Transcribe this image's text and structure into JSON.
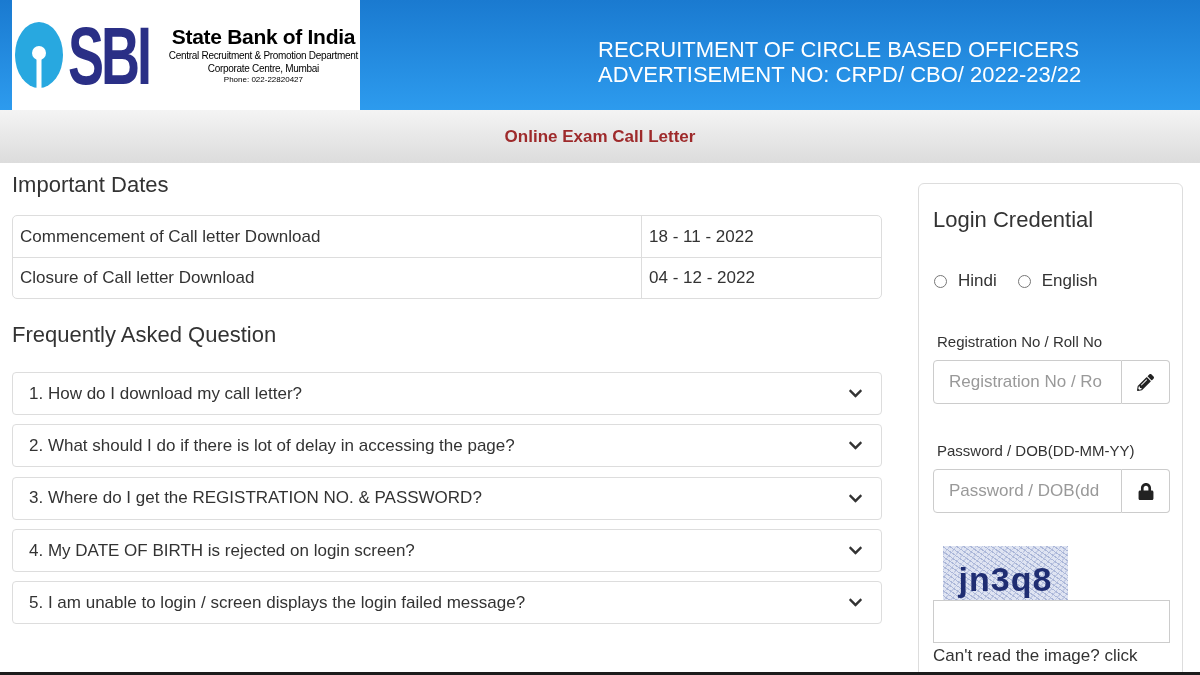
{
  "header": {
    "logo": {
      "mark": "SBI",
      "name": "State Bank of India",
      "department": "Central Recruitment & Promotion Department",
      "office": "Corporate Centre, Mumbai",
      "phone": "Phone: 022-22820427"
    },
    "title_lines": [
      "RECRUITMENT OF CIRCLE BASED OFFICERS",
      "ADVERTISEMENT NO: CRPD/ CBO/ 2022-23/22"
    ]
  },
  "page_title": "Online Exam Call Letter",
  "important_dates": {
    "heading": "Important Dates",
    "rows": [
      {
        "event": "Commencement of Call letter Download",
        "date": "18 - 11 - 2022"
      },
      {
        "event": "Closure of Call letter Download",
        "date": "04 - 12 - 2022"
      }
    ]
  },
  "faq": {
    "heading": "Frequently Asked Question",
    "items": [
      {
        "question": "1. How do I download my call letter?",
        "expanded": false
      },
      {
        "question": "2. What should I do if there is lot of delay in accessing the page?",
        "expanded": false
      },
      {
        "question": "3. Where do I get the REGISTRATION NO. & PASSWORD?",
        "expanded": false
      },
      {
        "question": "4. My DATE OF BIRTH is rejected on login screen?",
        "expanded": false
      },
      {
        "question": "5. I am unable to login / screen displays the login failed message?",
        "expanded": false
      }
    ]
  },
  "login": {
    "heading": "Login Credential",
    "languages": [
      {
        "label": "Hindi",
        "selected": false
      },
      {
        "label": "English",
        "selected": false
      }
    ],
    "fields": [
      {
        "kind": "text",
        "label": "Registration No / Roll No",
        "placeholder": "Registration No / Ro"
      },
      {
        "kind": "password",
        "label": "Password / DOB(DD-MM-YY)",
        "placeholder": "Password / DOB(dd"
      }
    ],
    "captcha": {
      "text": "jn3q8"
    },
    "help_text": "Can't read the image? click"
  }
}
